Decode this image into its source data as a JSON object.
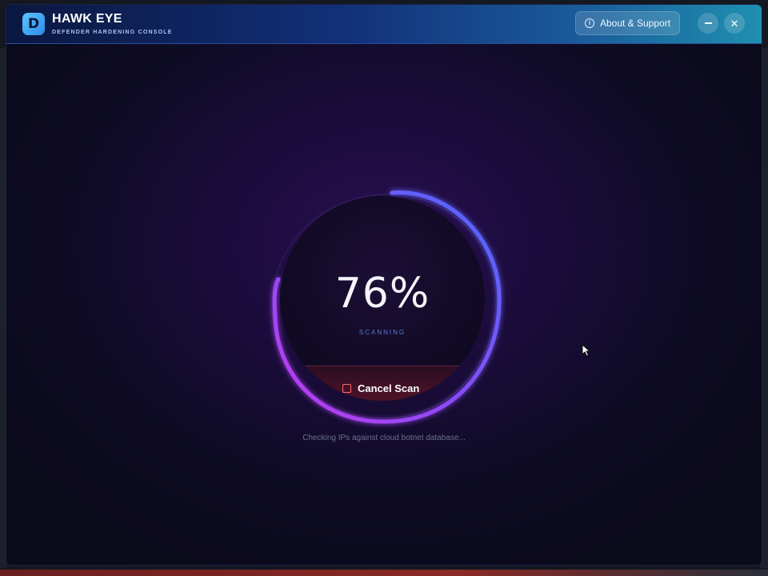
{
  "window": {
    "logo_letter": "D",
    "title": "HAWK EYE",
    "subtitle": "DEFENDER HARDENING CONSOLE",
    "about_label": "About & Support",
    "icons": {
      "info": "info-icon",
      "minimize": "minimize-icon",
      "close": "close-icon"
    }
  },
  "scan": {
    "progress_text": "76%",
    "progress": 76,
    "status": "SCANNING",
    "cancel_label": "Cancel Scan",
    "cancel_icon": "stop-icon",
    "detail": "Checking IPs against cloud botnet database..."
  },
  "colors": {
    "ring_start": "#4d6bff",
    "ring_end": "#b43cf0",
    "accent_blue": "#5b7fd6",
    "cancel_red": "#ff6b78"
  }
}
